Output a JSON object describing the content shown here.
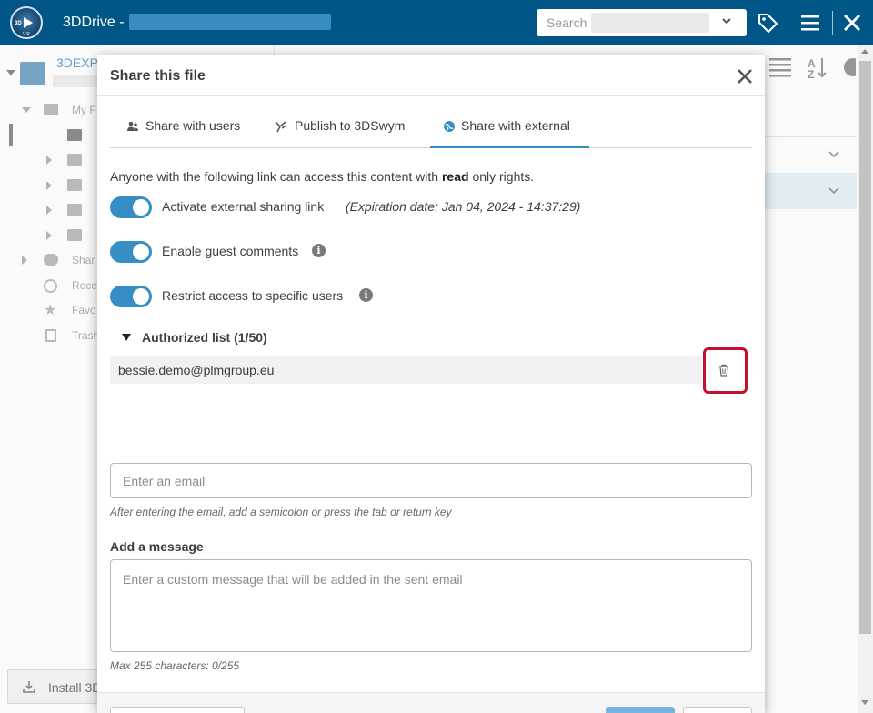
{
  "app": {
    "title": "3DDrive -",
    "logo_icon": "3dexperience-compass-icon",
    "logo_text_3d": "3D",
    "logo_text_vr": "V.R"
  },
  "search": {
    "placeholder": "Search"
  },
  "toolbar_icons": [
    "tag-icon",
    "menu-icon",
    "close-icon"
  ],
  "background": {
    "header_label": "3DEXP",
    "tree": [
      {
        "label": "My F"
      },
      {
        "label": "Shar"
      },
      {
        "label": "Rece"
      },
      {
        "label": "Favo"
      },
      {
        "label": "Trash"
      }
    ],
    "install_label": "Install 3D"
  },
  "modal": {
    "title": "Share this file",
    "tabs": [
      {
        "label": "Share with users",
        "icon": "users-icon",
        "active": false
      },
      {
        "label": "Publish to 3DSwym",
        "icon": "publish-icon",
        "active": false
      },
      {
        "label": "Share with external",
        "icon": "globe-icon",
        "active": true
      }
    ],
    "intro_prefix": "Anyone with the following link can access this content with ",
    "intro_bold": "read",
    "intro_suffix": " only rights.",
    "toggles": [
      {
        "label": "Activate external sharing link",
        "on": true
      },
      {
        "label": "Enable guest comments",
        "on": true
      },
      {
        "label": "Restrict access to specific users",
        "on": true
      }
    ],
    "expiration": "(Expiration date: Jan 04, 2024 - 14:37:29)",
    "authorized_list": {
      "label": "Authorized list (1/50)",
      "items": [
        "bessie.demo@plmgroup.eu"
      ]
    },
    "email": {
      "placeholder": "Enter an email",
      "hint": "After entering the email, add a semicolon or press the tab or return key"
    },
    "message": {
      "label": "Add a message",
      "placeholder": "Enter a custom message that will be added in the sent email",
      "counter": "Max 255 characters: 0/255"
    }
  },
  "colors": {
    "topbar": "#005686",
    "accent": "#368ec4",
    "highlight": "#c8102e"
  }
}
